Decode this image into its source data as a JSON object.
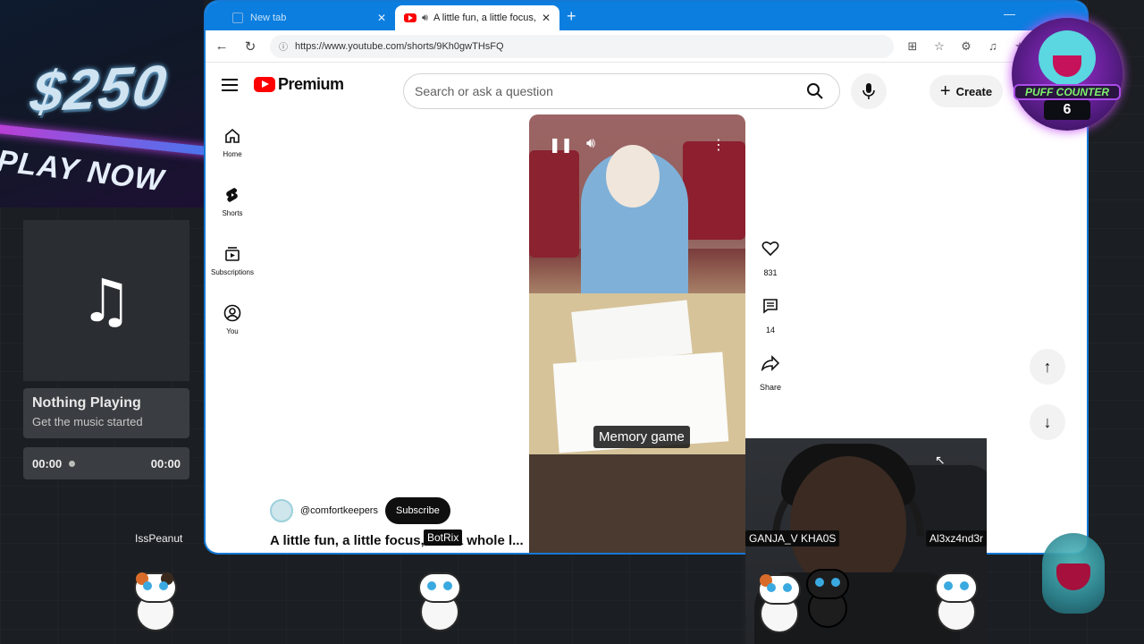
{
  "overlay": {
    "promo_amount": "$250",
    "promo_cta": "PLAY NOW",
    "music": {
      "icon": "music-note-icon",
      "title": "Nothing Playing",
      "subtitle": "Get the music started",
      "time_current": "00:00",
      "time_total": "00:00"
    },
    "puff_counter": {
      "label": "PUFF COUNTER",
      "count": "6"
    },
    "viewers": [
      "IssPeanut",
      "BotRix",
      "GANJA_V KHA0S",
      "Al3xz4nd3r"
    ]
  },
  "browser": {
    "tabs": [
      {
        "label": "New tab",
        "active": false
      },
      {
        "label": "A little fun, a little focus, and a",
        "active": true
      }
    ],
    "url": "https://www.youtube.com/shorts/9Kh0gwTHsFQ",
    "accent": "#0b7ee0"
  },
  "youtube": {
    "logo_text": "Premium",
    "search_placeholder": "Search or ask a question",
    "create_label": "Create",
    "sidebar": [
      {
        "label": "Home",
        "icon": "home-icon"
      },
      {
        "label": "Shorts",
        "icon": "shorts-icon"
      },
      {
        "label": "Subscriptions",
        "icon": "subscriptions-icon"
      },
      {
        "label": "You",
        "icon": "you-icon"
      }
    ],
    "video": {
      "caption": "Memory game",
      "channel_handle": "@comfortkeepers",
      "subscribe_label": "Subscribe",
      "title": "A little fun, a little focus, and a whole l..."
    },
    "actions": {
      "likes": "831",
      "comments": "14",
      "share_label": "Share"
    }
  }
}
